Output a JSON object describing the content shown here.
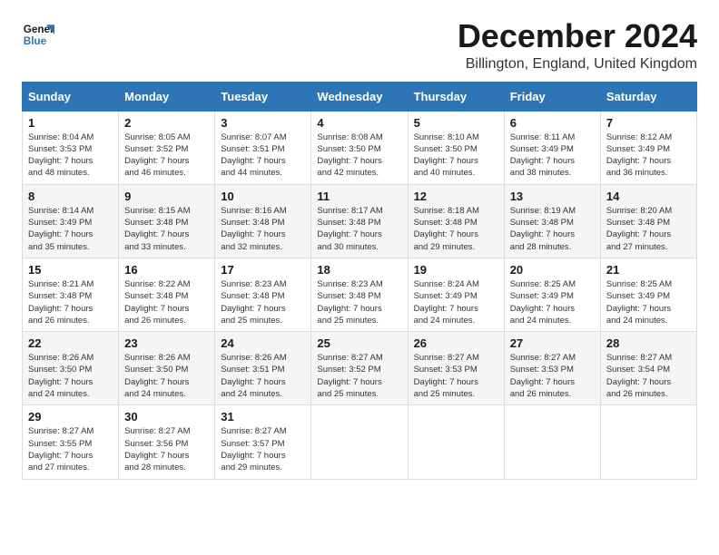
{
  "header": {
    "logo_line1": "General",
    "logo_line2": "Blue",
    "month_title": "December 2024",
    "location": "Billington, England, United Kingdom"
  },
  "calendar": {
    "headers": [
      "Sunday",
      "Monday",
      "Tuesday",
      "Wednesday",
      "Thursday",
      "Friday",
      "Saturday"
    ],
    "weeks": [
      [
        {
          "day": "",
          "info": ""
        },
        {
          "day": "2",
          "info": "Sunrise: 8:05 AM\nSunset: 3:52 PM\nDaylight: 7 hours\nand 46 minutes."
        },
        {
          "day": "3",
          "info": "Sunrise: 8:07 AM\nSunset: 3:51 PM\nDaylight: 7 hours\nand 44 minutes."
        },
        {
          "day": "4",
          "info": "Sunrise: 8:08 AM\nSunset: 3:50 PM\nDaylight: 7 hours\nand 42 minutes."
        },
        {
          "day": "5",
          "info": "Sunrise: 8:10 AM\nSunset: 3:50 PM\nDaylight: 7 hours\nand 40 minutes."
        },
        {
          "day": "6",
          "info": "Sunrise: 8:11 AM\nSunset: 3:49 PM\nDaylight: 7 hours\nand 38 minutes."
        },
        {
          "day": "7",
          "info": "Sunrise: 8:12 AM\nSunset: 3:49 PM\nDaylight: 7 hours\nand 36 minutes."
        }
      ],
      [
        {
          "day": "1",
          "info": "Sunrise: 8:04 AM\nSunset: 3:53 PM\nDaylight: 7 hours\nand 48 minutes."
        },
        {
          "day": "9",
          "info": "Sunrise: 8:15 AM\nSunset: 3:48 PM\nDaylight: 7 hours\nand 33 minutes."
        },
        {
          "day": "10",
          "info": "Sunrise: 8:16 AM\nSunset: 3:48 PM\nDaylight: 7 hours\nand 32 minutes."
        },
        {
          "day": "11",
          "info": "Sunrise: 8:17 AM\nSunset: 3:48 PM\nDaylight: 7 hours\nand 30 minutes."
        },
        {
          "day": "12",
          "info": "Sunrise: 8:18 AM\nSunset: 3:48 PM\nDaylight: 7 hours\nand 29 minutes."
        },
        {
          "day": "13",
          "info": "Sunrise: 8:19 AM\nSunset: 3:48 PM\nDaylight: 7 hours\nand 28 minutes."
        },
        {
          "day": "14",
          "info": "Sunrise: 8:20 AM\nSunset: 3:48 PM\nDaylight: 7 hours\nand 27 minutes."
        }
      ],
      [
        {
          "day": "8",
          "info": "Sunrise: 8:14 AM\nSunset: 3:49 PM\nDaylight: 7 hours\nand 35 minutes."
        },
        {
          "day": "16",
          "info": "Sunrise: 8:22 AM\nSunset: 3:48 PM\nDaylight: 7 hours\nand 26 minutes."
        },
        {
          "day": "17",
          "info": "Sunrise: 8:23 AM\nSunset: 3:48 PM\nDaylight: 7 hours\nand 25 minutes."
        },
        {
          "day": "18",
          "info": "Sunrise: 8:23 AM\nSunset: 3:48 PM\nDaylight: 7 hours\nand 25 minutes."
        },
        {
          "day": "19",
          "info": "Sunrise: 8:24 AM\nSunset: 3:49 PM\nDaylight: 7 hours\nand 24 minutes."
        },
        {
          "day": "20",
          "info": "Sunrise: 8:25 AM\nSunset: 3:49 PM\nDaylight: 7 hours\nand 24 minutes."
        },
        {
          "day": "21",
          "info": "Sunrise: 8:25 AM\nSunset: 3:49 PM\nDaylight: 7 hours\nand 24 minutes."
        }
      ],
      [
        {
          "day": "15",
          "info": "Sunrise: 8:21 AM\nSunset: 3:48 PM\nDaylight: 7 hours\nand 26 minutes."
        },
        {
          "day": "23",
          "info": "Sunrise: 8:26 AM\nSunset: 3:50 PM\nDaylight: 7 hours\nand 24 minutes."
        },
        {
          "day": "24",
          "info": "Sunrise: 8:26 AM\nSunset: 3:51 PM\nDaylight: 7 hours\nand 24 minutes."
        },
        {
          "day": "25",
          "info": "Sunrise: 8:27 AM\nSunset: 3:52 PM\nDaylight: 7 hours\nand 25 minutes."
        },
        {
          "day": "26",
          "info": "Sunrise: 8:27 AM\nSunset: 3:53 PM\nDaylight: 7 hours\nand 25 minutes."
        },
        {
          "day": "27",
          "info": "Sunrise: 8:27 AM\nSunset: 3:53 PM\nDaylight: 7 hours\nand 26 minutes."
        },
        {
          "day": "28",
          "info": "Sunrise: 8:27 AM\nSunset: 3:54 PM\nDaylight: 7 hours\nand 26 minutes."
        }
      ],
      [
        {
          "day": "22",
          "info": "Sunrise: 8:26 AM\nSunset: 3:50 PM\nDaylight: 7 hours\nand 24 minutes."
        },
        {
          "day": "30",
          "info": "Sunrise: 8:27 AM\nSunset: 3:56 PM\nDaylight: 7 hours\nand 28 minutes."
        },
        {
          "day": "31",
          "info": "Sunrise: 8:27 AM\nSunset: 3:57 PM\nDaylight: 7 hours\nand 29 minutes."
        },
        {
          "day": "",
          "info": ""
        },
        {
          "day": "",
          "info": ""
        },
        {
          "day": "",
          "info": ""
        },
        {
          "day": "",
          "info": ""
        }
      ],
      [
        {
          "day": "29",
          "info": "Sunrise: 8:27 AM\nSunset: 3:55 PM\nDaylight: 7 hours\nand 27 minutes."
        },
        {
          "day": "",
          "info": ""
        },
        {
          "day": "",
          "info": ""
        },
        {
          "day": "",
          "info": ""
        },
        {
          "day": "",
          "info": ""
        },
        {
          "day": "",
          "info": ""
        },
        {
          "day": "",
          "info": ""
        }
      ]
    ]
  }
}
